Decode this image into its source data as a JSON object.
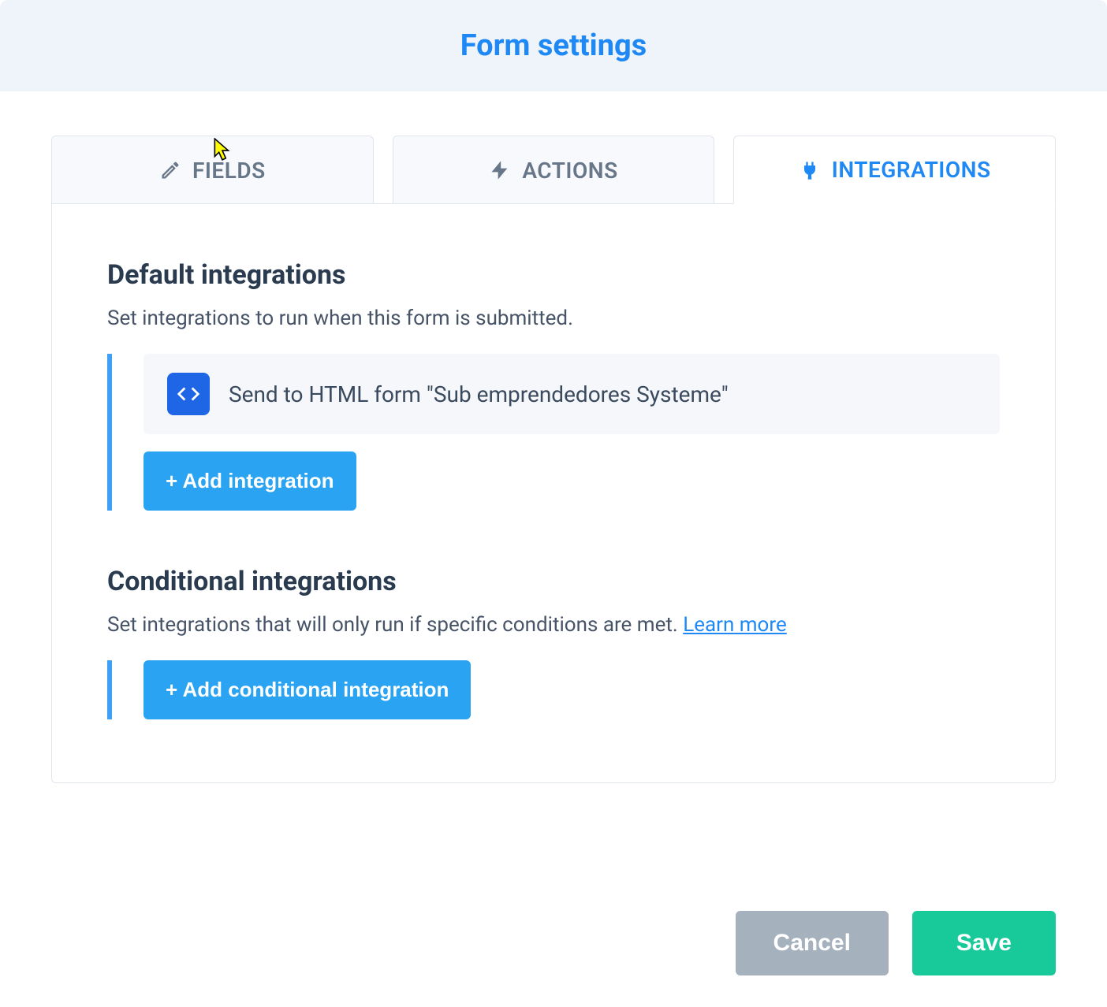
{
  "header": {
    "title": "Form settings"
  },
  "tabs": {
    "fields": {
      "label": "FIELDS"
    },
    "actions": {
      "label": "ACTIONS"
    },
    "integrations": {
      "label": "INTEGRATIONS"
    }
  },
  "sections": {
    "default": {
      "title": "Default integrations",
      "desc": "Set integrations to run when this form is submitted.",
      "item": {
        "label": "Send to HTML form \"Sub emprendedores Systeme\""
      },
      "add_btn": "+ Add integration"
    },
    "conditional": {
      "title": "Conditional integrations",
      "desc_prefix": "Set integrations that will only run if specific conditions are met. ",
      "learn_more": "Learn more",
      "add_btn": "+ Add conditional integration"
    }
  },
  "footer": {
    "cancel": "Cancel",
    "save": "Save"
  }
}
